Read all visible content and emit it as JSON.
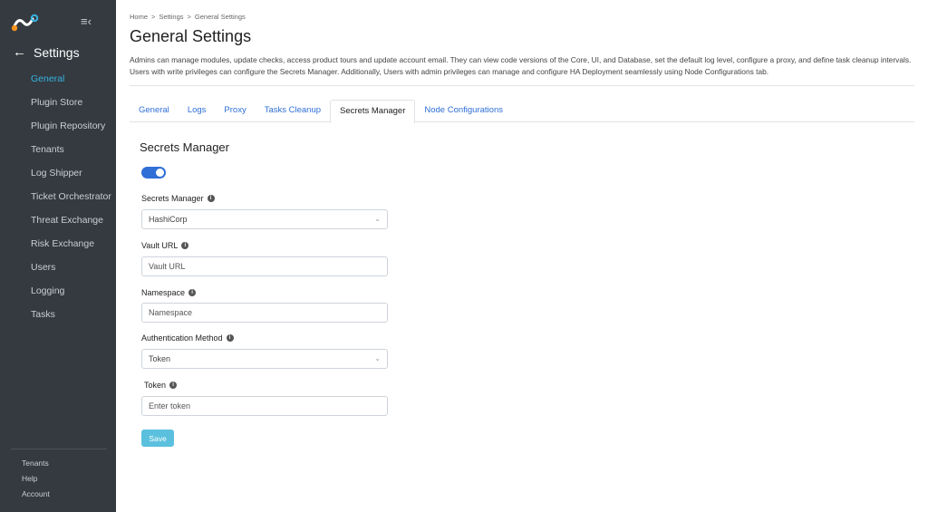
{
  "sidebar": {
    "back_label": "Settings",
    "items": [
      {
        "label": "General",
        "active": true
      },
      {
        "label": "Plugin Store"
      },
      {
        "label": "Plugin Repository"
      },
      {
        "label": "Tenants"
      },
      {
        "label": "Log Shipper"
      },
      {
        "label": "Ticket Orchestrator"
      },
      {
        "label": "Threat Exchange"
      },
      {
        "label": "Risk Exchange"
      },
      {
        "label": "Users"
      },
      {
        "label": "Logging"
      },
      {
        "label": "Tasks"
      }
    ],
    "bottom": {
      "tenants": "Tenants",
      "help": "Help",
      "account": "Account"
    }
  },
  "breadcrumb": {
    "home": "Home",
    "settings": "Settings",
    "current": "General Settings",
    "separator": ">"
  },
  "page": {
    "title": "General Settings",
    "description": "Admins can manage modules, update checks, access product tours and update account email. They can view code versions of the Core, UI, and Database, set the default log level, configure a proxy, and define task cleanup intervals. Users with write privileges can configure the Secrets Manager. Additionally, Users with admin privileges can manage and configure HA Deployment seamlessly using Node Configurations tab."
  },
  "tabs": [
    {
      "label": "General"
    },
    {
      "label": "Logs"
    },
    {
      "label": "Proxy"
    },
    {
      "label": "Tasks Cleanup"
    },
    {
      "label": "Secrets Manager",
      "active": true
    },
    {
      "label": "Node Configurations"
    }
  ],
  "form": {
    "section_title": "Secrets Manager",
    "enabled": true,
    "secrets_manager": {
      "label": "Secrets Manager",
      "value": "HashiCorp"
    },
    "vault_url": {
      "label": "Vault URL",
      "placeholder": "Vault URL"
    },
    "namespace": {
      "label": "Namespace",
      "placeholder": "Namespace"
    },
    "auth_method": {
      "label": "Authentication Method",
      "value": "Token"
    },
    "token": {
      "label": "Token",
      "placeholder": "Enter token"
    },
    "save_label": "Save"
  },
  "colors": {
    "sidebar_bg": "#343a40",
    "accent": "#37b3e0",
    "link": "#2f6fd6",
    "save_button": "#5bc0de"
  }
}
